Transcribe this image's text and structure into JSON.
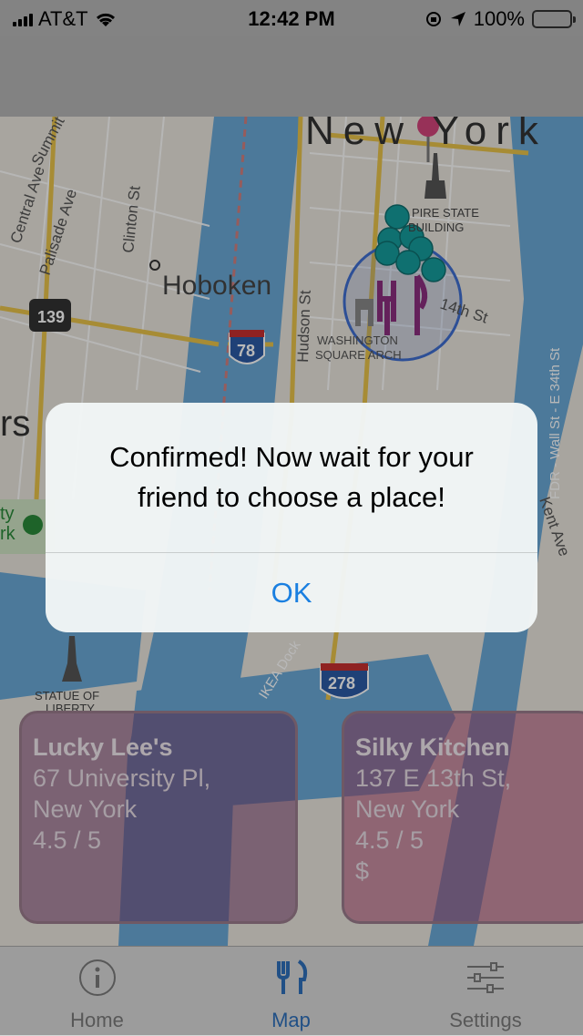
{
  "status_bar": {
    "carrier": "AT&T",
    "time": "12:42 PM",
    "battery": "100%",
    "battery_level": 1.0,
    "battery_color": "#ffcc00"
  },
  "map": {
    "labels": {
      "city": "New York",
      "hoboken": "Hoboken",
      "empire_1": "PIRE STATE",
      "empire_2": "BUILDING",
      "washington_1": "WASHINGTON",
      "washington_2": "SQUARE ARCH",
      "statue_1": "STATUE OF",
      "statue_2": "LIBERTY",
      "summit": "Summit",
      "central": "Central Ave",
      "palisade": "Palisade Ave",
      "clinton": "Clinton St",
      "hudson": "Hudson St",
      "street14": "14th St",
      "wall": "FDR - Wall St - E 34th St",
      "kent": "Kent Ave",
      "ikea": "IKEA Dock",
      "route139": "139",
      "route78": "78",
      "route278": "278",
      "left_frag": "rs",
      "left_frag2": "ty",
      "left_frag3": "rk"
    },
    "pin_color": "#d1447a",
    "cluster_color": "#169c9c",
    "restaurant_icon_color": "#8b2e7e"
  },
  "alert": {
    "message": "Confirmed! Now wait for your friend to choose a place!",
    "ok_label": "OK"
  },
  "cards": [
    {
      "name": "Lucky Lee's",
      "address_1": "67 University Pl,",
      "address_2": "New York",
      "rating": "4.5 / 5",
      "price": ""
    },
    {
      "name": "Silky Kitchen",
      "address_1": "137 E 13th St,",
      "address_2": "New York",
      "rating": "4.5 / 5",
      "price": "$"
    }
  ],
  "tabs": [
    {
      "label": "Home",
      "icon": "info-icon"
    },
    {
      "label": "Map",
      "icon": "fork-knife-icon"
    },
    {
      "label": "Settings",
      "icon": "sliders-icon"
    }
  ],
  "active_tab": "Map",
  "accent_color": "#1a7fe0"
}
